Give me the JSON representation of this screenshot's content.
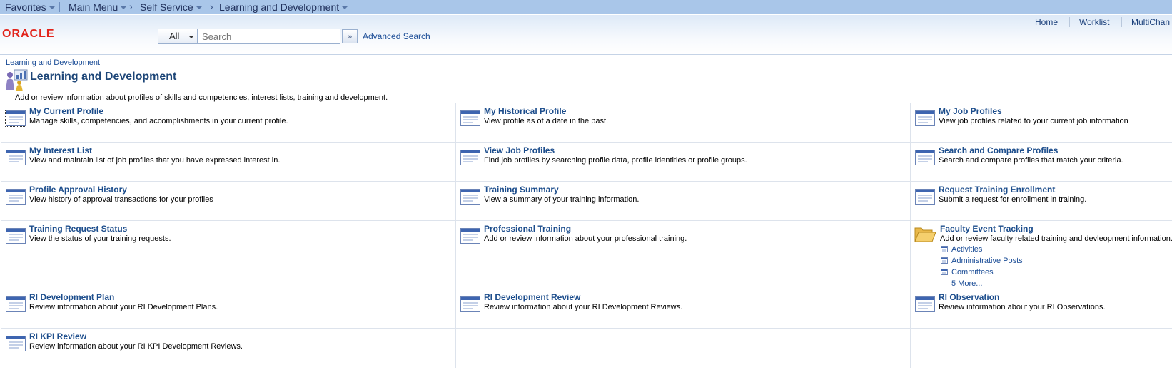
{
  "topnav": {
    "favorites": "Favorites",
    "main_menu": "Main Menu",
    "crumbs": [
      "Self Service",
      "Learning and Development"
    ]
  },
  "header": {
    "logo": "ORACLE",
    "search_category": "All",
    "search_placeholder": "Search",
    "search_go_glyph": "»",
    "advanced_search": "Advanced Search",
    "links": [
      "Home",
      "Worklist",
      "MultiChan"
    ]
  },
  "page": {
    "breadcrumb": "Learning and Development",
    "title": "Learning and Development",
    "description": "Add or review information about profiles of skills and competencies, interest lists, training and development."
  },
  "items": [
    {
      "title": "My Current Profile",
      "desc": "Manage skills, competencies, and accomplishments in your current profile."
    },
    {
      "title": "My Historical Profile",
      "desc": "View profile as of a date in the past."
    },
    {
      "title": "My Job Profiles",
      "desc": "View job profiles related to your current job information"
    },
    {
      "title": "My Interest List",
      "desc": "View and maintain list of job profiles that you have expressed interest in."
    },
    {
      "title": "View Job Profiles",
      "desc": "Find job profiles by searching profile data, profile identities or profile groups."
    },
    {
      "title": "Search and Compare Profiles",
      "desc": "Search and compare profiles that match your criteria."
    },
    {
      "title": "Profile Approval History",
      "desc": "View history of approval transactions for your profiles"
    },
    {
      "title": "Training Summary",
      "desc": "View a summary of your training information."
    },
    {
      "title": "Request Training Enrollment",
      "desc": "Submit a request for enrollment in training."
    },
    {
      "title": "Training Request Status",
      "desc": "View the status of your training requests."
    },
    {
      "title": "Professional Training",
      "desc": "Add or review information about your professional training."
    },
    {
      "title": "Faculty Event Tracking",
      "desc": "Add or review faculty related training and devleopment information.",
      "sublinks": [
        "Activities",
        "Administrative Posts",
        "Committees"
      ],
      "more": "5 More..."
    },
    {
      "title": "RI Development Plan",
      "desc": "Review information about your RI Development Plans."
    },
    {
      "title": "RI Development Review",
      "desc": "Review information about your RI Development Reviews."
    },
    {
      "title": "RI Observation",
      "desc": "Review information about your RI Observations."
    },
    {
      "title": "RI KPI Review",
      "desc": "Review information about your RI KPI Development Reviews."
    }
  ]
}
